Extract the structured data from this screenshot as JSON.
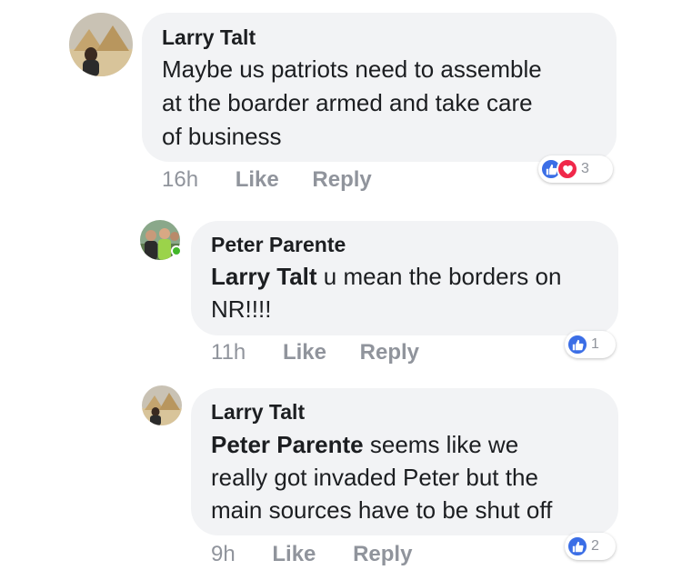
{
  "comments": [
    {
      "author": "Larry Talt",
      "line1": "Maybe us patriots need to assemble",
      "line2": "at the boarder armed and take care",
      "line3": "of business",
      "time": "16h",
      "like": "Like",
      "reply": "Reply",
      "reaction_count": "3",
      "reaction_icons": [
        "like-icon",
        "love-icon"
      ]
    },
    {
      "author": "Peter Parente",
      "mention": "Larry Talt",
      "line1_rest": " u mean the borders on",
      "line2": "NR!!!!",
      "time": "11h",
      "like": "Like",
      "reply": "Reply",
      "reaction_count": "1",
      "reaction_icons": [
        "like-icon"
      ],
      "online": true
    },
    {
      "author": "Larry Talt",
      "mention": "Peter Parente",
      "line1_rest": " seems like we",
      "line2": "really got invaded Peter but the",
      "line3": "main sources have to be shut off",
      "time": "9h",
      "like": "Like",
      "reply": "Reply",
      "reaction_count": "2",
      "reaction_icons": [
        "like-icon"
      ]
    }
  ],
  "colors": {
    "bubble": "#f2f3f5",
    "meta_text": "#90949c",
    "like_blue": "#3b6ee6",
    "love_red": "#f0284a",
    "online_green": "#42b72a"
  }
}
